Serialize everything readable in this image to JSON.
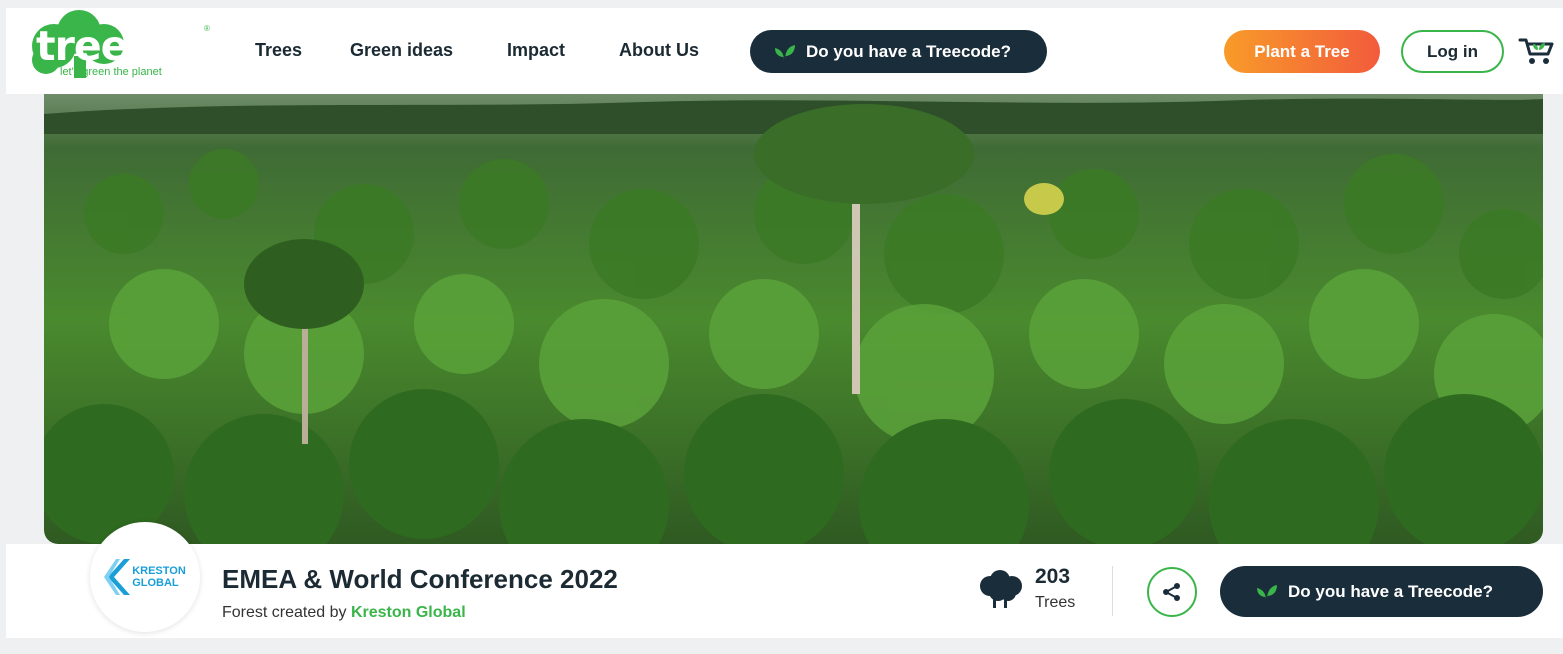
{
  "brand": {
    "name": "treedom",
    "tagline": "let's green the planet",
    "reg": "®",
    "color": "#3ab54a"
  },
  "nav": {
    "items": [
      "Trees",
      "Green ideas",
      "Impact",
      "About Us"
    ],
    "treecode_label": "Do you have a Treecode?",
    "plant_label": "Plant a Tree",
    "login_label": "Log in"
  },
  "icons": {
    "cart": "cart-icon",
    "leaf": "leaf-icon",
    "trees": "trees-icon",
    "share": "share-icon"
  },
  "forest": {
    "title": "EMEA & World Conference 2022",
    "created_by_prefix": "Forest created by",
    "creator": "Kreston Global",
    "logo_line1": "KRESTON",
    "logo_line2": "GLOBAL",
    "tree_count": "203",
    "tree_label": "Trees",
    "treecode_label": "Do you have a Treecode?"
  },
  "colors": {
    "dark": "#1a2d3a",
    "green": "#3ab54a",
    "orange_start": "#f89b29",
    "orange_end": "#f25b3c",
    "kreston_blue": "#1a9ed8"
  }
}
